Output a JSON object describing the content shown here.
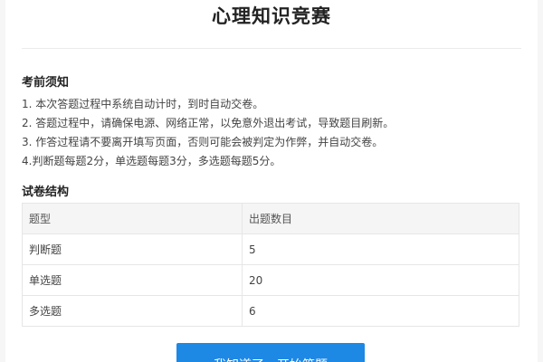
{
  "header": {
    "title": "心理知识竞赛"
  },
  "notice": {
    "heading": "考前须知",
    "items": [
      "1. 本次答题过程中系统自动计时，到时自动交卷。",
      "2. 答题过程中，请确保电源、网络正常，以免意外退出考试，导致题目刷新。",
      "3. 作答过程请不要离开填写页面，否则可能会被判定为作弊，并自动交卷。",
      "4.判断题每题2分，单选题每题3分，多选题每题5分。"
    ]
  },
  "structure": {
    "heading": "试卷结构",
    "columns": [
      "题型",
      "出题数目"
    ],
    "rows": [
      [
        "判断题",
        "5"
      ],
      [
        "单选题",
        "20"
      ],
      [
        "多选题",
        "6"
      ]
    ]
  },
  "actions": {
    "start_label": "我知道了，开始答题"
  },
  "colors": {
    "primary_button": "#1e88e5",
    "page_background": "#ffffff",
    "outer_background": "#f6f6f6"
  }
}
